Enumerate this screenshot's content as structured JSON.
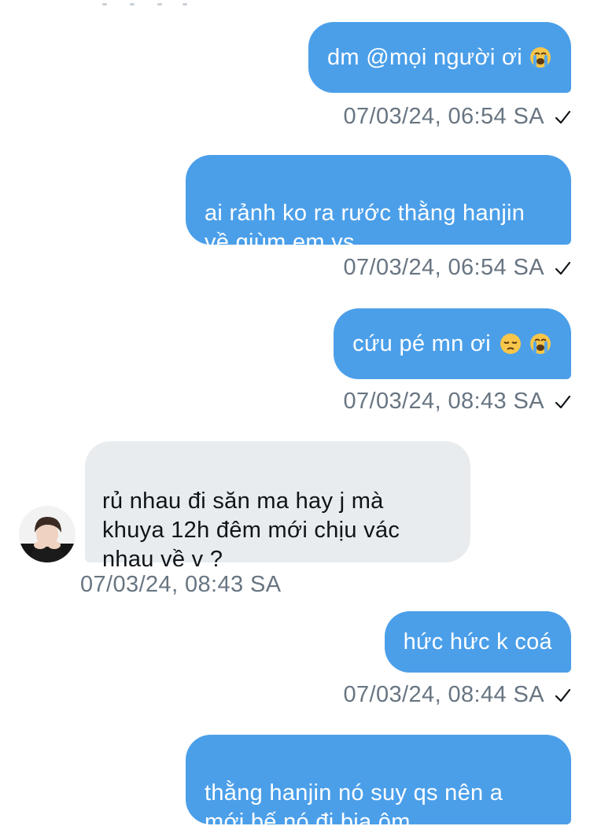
{
  "messages": [
    {
      "side": "sent",
      "text": "dm @mọi người ơi",
      "emoji": [
        "crying-face"
      ],
      "timestamp": "07/03/24, 06:54 SA",
      "read_check": true
    },
    {
      "side": "sent",
      "text": "ai rảnh ko ra rước thằng hanjin\nvề giùm em vs",
      "timestamp": "07/03/24, 06:54 SA",
      "read_check": true
    },
    {
      "side": "sent",
      "text": "cứu pé mn ơi",
      "emoji": [
        "pensive-face",
        "crying-face"
      ],
      "timestamp": "07/03/24, 08:43 SA",
      "read_check": true
    },
    {
      "side": "received",
      "text": "rủ nhau đi săn ma hay j mà\nkhuya 12h đêm mới chịu vác\nnhau về v ?",
      "timestamp": "07/03/24, 08:43 SA",
      "avatar": "user-avatar"
    },
    {
      "side": "sent",
      "text": "hức hức k coá",
      "timestamp": "07/03/24, 08:44 SA",
      "read_check": true
    },
    {
      "side": "sent",
      "text": "thằng hanjin nó suy qs nên a\nmới bế nó đi bia ôm"
    }
  ],
  "colors": {
    "sent_bubble": "#4b9fe9",
    "received_bubble": "#e8ecef",
    "timestamp": "#687582",
    "emoji_yellow": "#f7c64a",
    "tear_blue": "#59a9e8"
  },
  "icons": {
    "read_check": "check-icon",
    "crying": "loudly-crying-face-emoji",
    "pensive": "pensive-face-emoji"
  }
}
